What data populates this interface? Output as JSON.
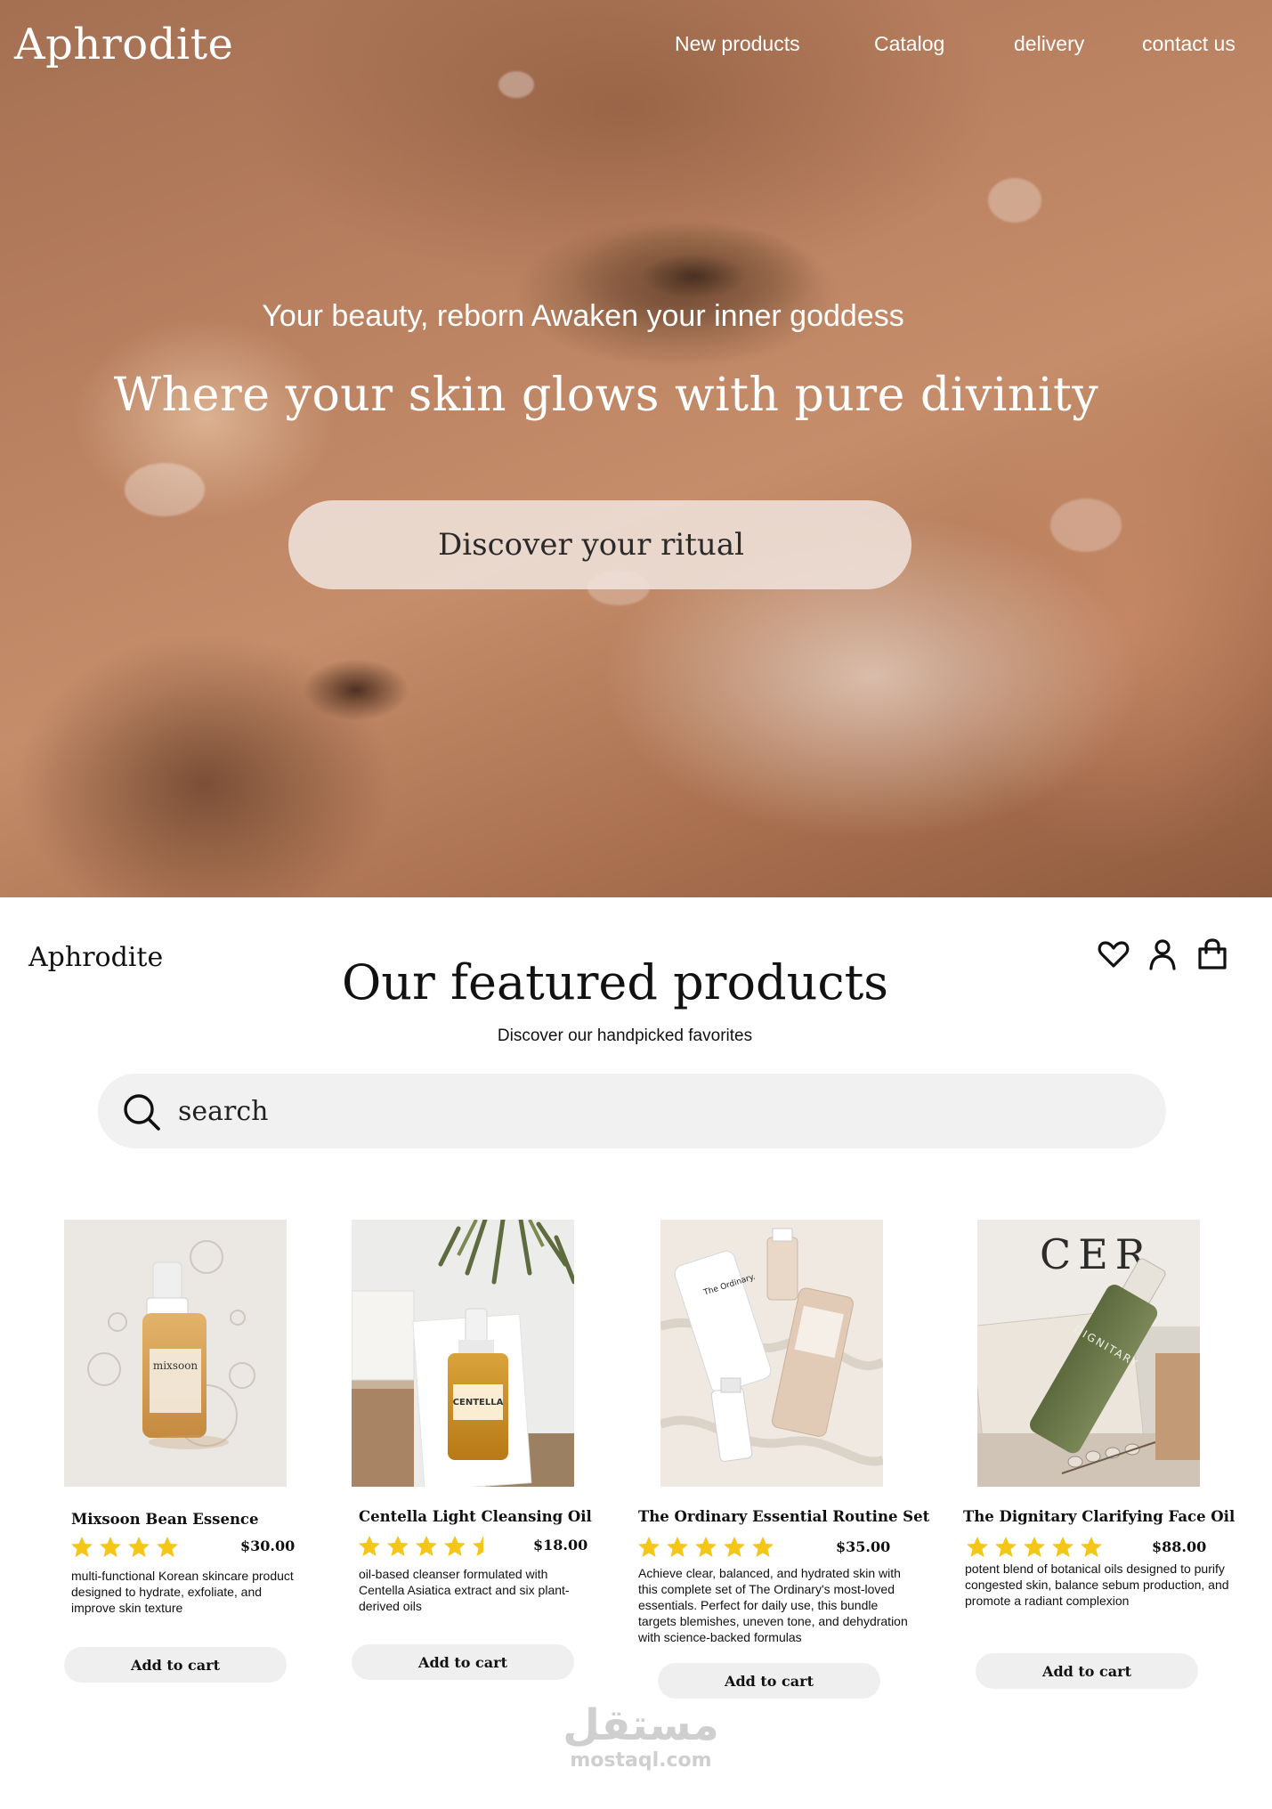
{
  "brand": "Aphrodite",
  "nav": {
    "items": [
      "New products",
      "Catalog",
      "delivery",
      "contact us"
    ]
  },
  "hero": {
    "tagline": "Your beauty, reborn  Awaken your inner goddess",
    "headline": "Where your skin glows with pure divinity",
    "cta_label": "Discover your ritual"
  },
  "header_icons": [
    "heart-icon",
    "user-icon",
    "shopping-bag-icon"
  ],
  "featured": {
    "title": "Our featured products",
    "subtitle": "Discover our handpicked favorites"
  },
  "search": {
    "placeholder": "search"
  },
  "colors": {
    "star": "#f5c518",
    "button_bg": "#efefef",
    "search_bg": "#f1f1f1"
  },
  "products": [
    {
      "name": "Mixsoon Bean Essence",
      "price": "$30.00",
      "rating": 4,
      "description": "multi-functional Korean skincare product designed to hydrate, exfoliate, and improve skin texture",
      "cta": "Add to cart"
    },
    {
      "name": "Centella Light Cleansing Oil",
      "price": "$18.00",
      "rating": 4.5,
      "description": "oil-based cleanser formulated with Centella Asiatica extract and six plant-derived oils",
      "cta": "Add to cart"
    },
    {
      "name": "The Ordinary Essential Routine Set",
      "price": "$35.00",
      "rating": 5,
      "description": "Achieve clear, balanced, and hydrated skin with this complete set of The Ordinary's most-loved essentials. Perfect for daily use, this bundle targets blemishes, uneven tone, and dehydration with science-backed formulas",
      "cta": "Add to cart"
    },
    {
      "name": "The Dignitary Clarifying Face Oil",
      "price": "$88.00",
      "rating": 5,
      "description": "potent blend of botanical oils designed to purify congested skin, balance sebum production, and promote a radiant complexion",
      "cta": "Add to cart"
    }
  ],
  "product_image_labels": {
    "mixsoon": "mixsoon",
    "centella": "CENTELLA",
    "ordinary": "The Ordinary.",
    "dignitary": "DIGNITARY"
  },
  "watermark": {
    "arabic": "مستقل",
    "latin": "mostaql.com"
  }
}
